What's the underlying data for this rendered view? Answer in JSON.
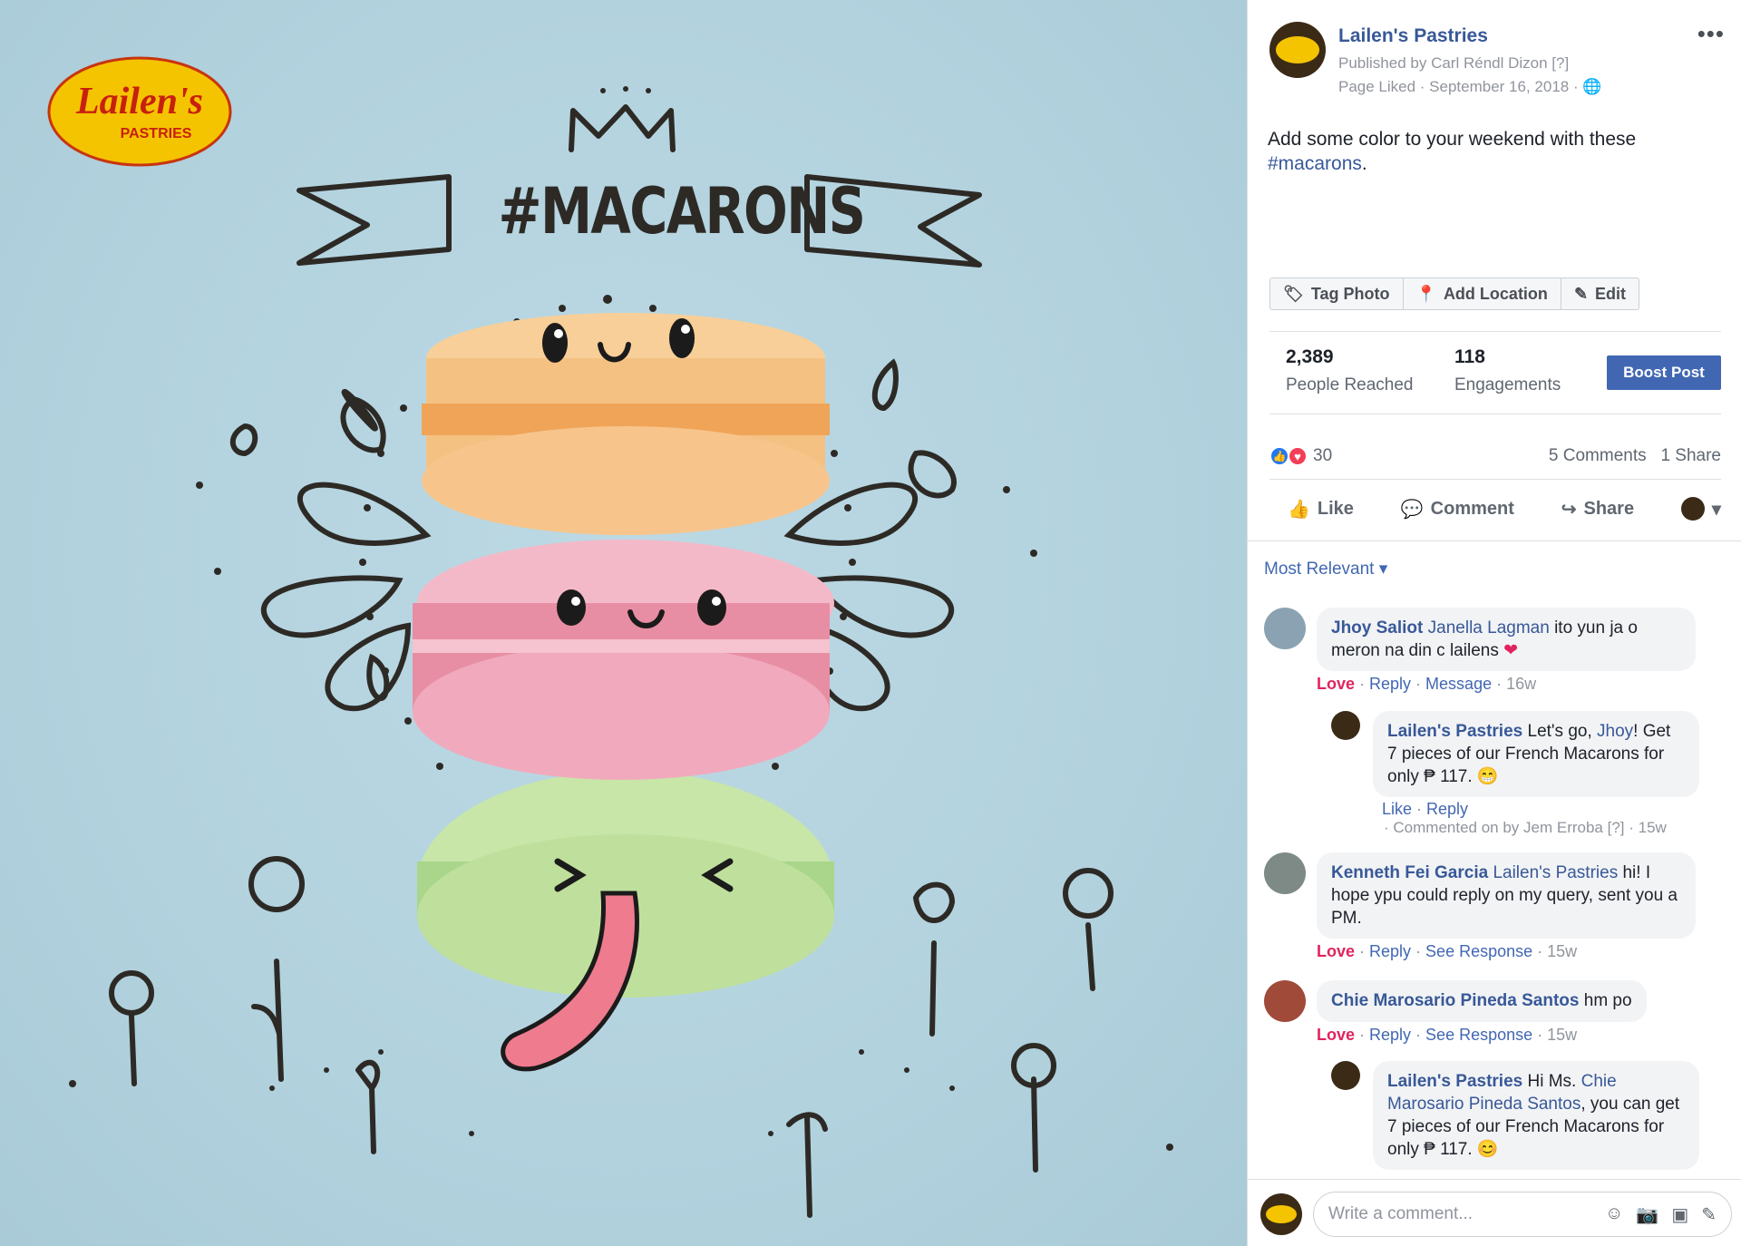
{
  "photo": {
    "logo_text": "Lailen's",
    "logo_sub": "PASTRIES",
    "headline": "#MACARONS"
  },
  "post": {
    "page_name": "Lailen's Pastries",
    "published_by": "Published by Carl Réndl Dizon [?]",
    "meta": "Page Liked · September 16, 2018 ·",
    "more": "•••",
    "text_main": "Add some color to your weekend with these",
    "hashtag": "#macarons",
    "text_end": "."
  },
  "photo_actions": {
    "tag_photo": "Tag Photo",
    "add_location": "Add Location",
    "edit": "Edit"
  },
  "insights": {
    "reached_value": "2,389",
    "reached_label": "People Reached",
    "engagements_value": "118",
    "engagements_label": "Engagements",
    "boost_label": "Boost Post"
  },
  "reactions": {
    "count": "30",
    "comments": "5 Comments",
    "shares": "1 Share"
  },
  "actions": {
    "like": "Like",
    "comment": "Comment",
    "share": "Share"
  },
  "sort_label": "Most Relevant",
  "comments": [
    {
      "name": "Jhoy Saliot",
      "tag": "Janella Lagman",
      "text": "ito yun ja o meron na din c lailens",
      "love": "Love",
      "reply": "Reply",
      "extra": "Message",
      "time": "16w"
    },
    {
      "name": "Lailen's Pastries",
      "text_a": "Let's go,",
      "tag": "Jhoy",
      "text_b": "! Get 7 pieces of our French Macarons for only ₱ 117. 😁",
      "like": "Like",
      "reply": "Reply",
      "commented_on": "Commented on by Jem Erroba [?] · 15w"
    },
    {
      "name": "Kenneth Fei Garcia",
      "tag": "Lailen's Pastries",
      "text": "hi! I hope ypu could reply on my query, sent you a PM.",
      "love": "Love",
      "reply": "Reply",
      "extra": "See Response",
      "time": "15w"
    },
    {
      "name": "Chie Marosario Pineda Santos",
      "text": "hm po",
      "love": "Love",
      "reply": "Reply",
      "extra": "See Response",
      "time": "15w"
    },
    {
      "name": "Lailen's Pastries",
      "text_a": "Hi Ms.",
      "tag": "Chie Marosario Pineda Santos",
      "text_b": ", you can get 7 pieces of our French Macarons for only ₱ 117. 😊"
    }
  ],
  "composer": {
    "placeholder": "Write a comment..."
  },
  "colors": {
    "fb_blue": "#4267b2",
    "link_blue": "#385898",
    "love_red": "#e0245e",
    "photo_bg": "#b4d3df"
  }
}
